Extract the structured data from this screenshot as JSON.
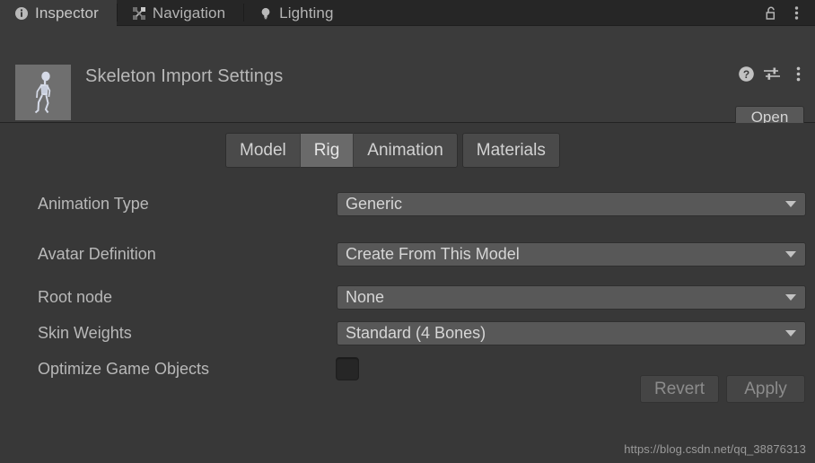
{
  "window": {
    "tabs": [
      {
        "label": "Inspector",
        "icon": "info-circle-icon",
        "active": true
      },
      {
        "label": "Navigation",
        "icon": "move-arrows-icon",
        "active": false
      },
      {
        "label": "Lighting",
        "icon": "lightbulb-icon",
        "active": false
      }
    ],
    "right_icons": [
      {
        "name": "lock-open-icon"
      },
      {
        "name": "more-vertical-icon"
      }
    ]
  },
  "header": {
    "title": "Skeleton Import Settings",
    "thumbnail_icon": "skeleton-model-thumbnail",
    "icons": [
      {
        "name": "help-circle-icon"
      },
      {
        "name": "preset-sliders-icon"
      },
      {
        "name": "more-vertical-icon"
      }
    ],
    "open_label": "Open"
  },
  "tab_group": [
    {
      "label": "Model",
      "selected": false
    },
    {
      "label": "Rig",
      "selected": true
    },
    {
      "label": "Animation",
      "selected": false
    },
    {
      "label": "Materials",
      "selected": false
    }
  ],
  "properties": [
    {
      "label": "Animation Type",
      "control": "dropdown",
      "value": "Generic"
    },
    {
      "label": "Avatar Definition",
      "control": "dropdown",
      "value": "Create From This Model"
    },
    {
      "label": "Root node",
      "control": "dropdown",
      "value": "None"
    },
    {
      "label": "Skin Weights",
      "control": "dropdown",
      "value": "Standard (4 Bones)"
    },
    {
      "label": "Optimize Game Objects",
      "control": "checkbox",
      "value": "",
      "checked": false
    }
  ],
  "footer": {
    "revert_label": "Revert",
    "apply_label": "Apply"
  },
  "watermark": "https://blog.csdn.net/qq_38876313",
  "colors": {
    "tabbar_bg": "#262626",
    "panel_bg": "#383838",
    "header_bg": "#3b3b3b",
    "control_bg": "#585858",
    "segment_bg": "#4a4a4a",
    "segment_selected_bg": "#6a6a6a",
    "text": "#b8b8b8",
    "text_disabled": "#8c8c8c"
  }
}
